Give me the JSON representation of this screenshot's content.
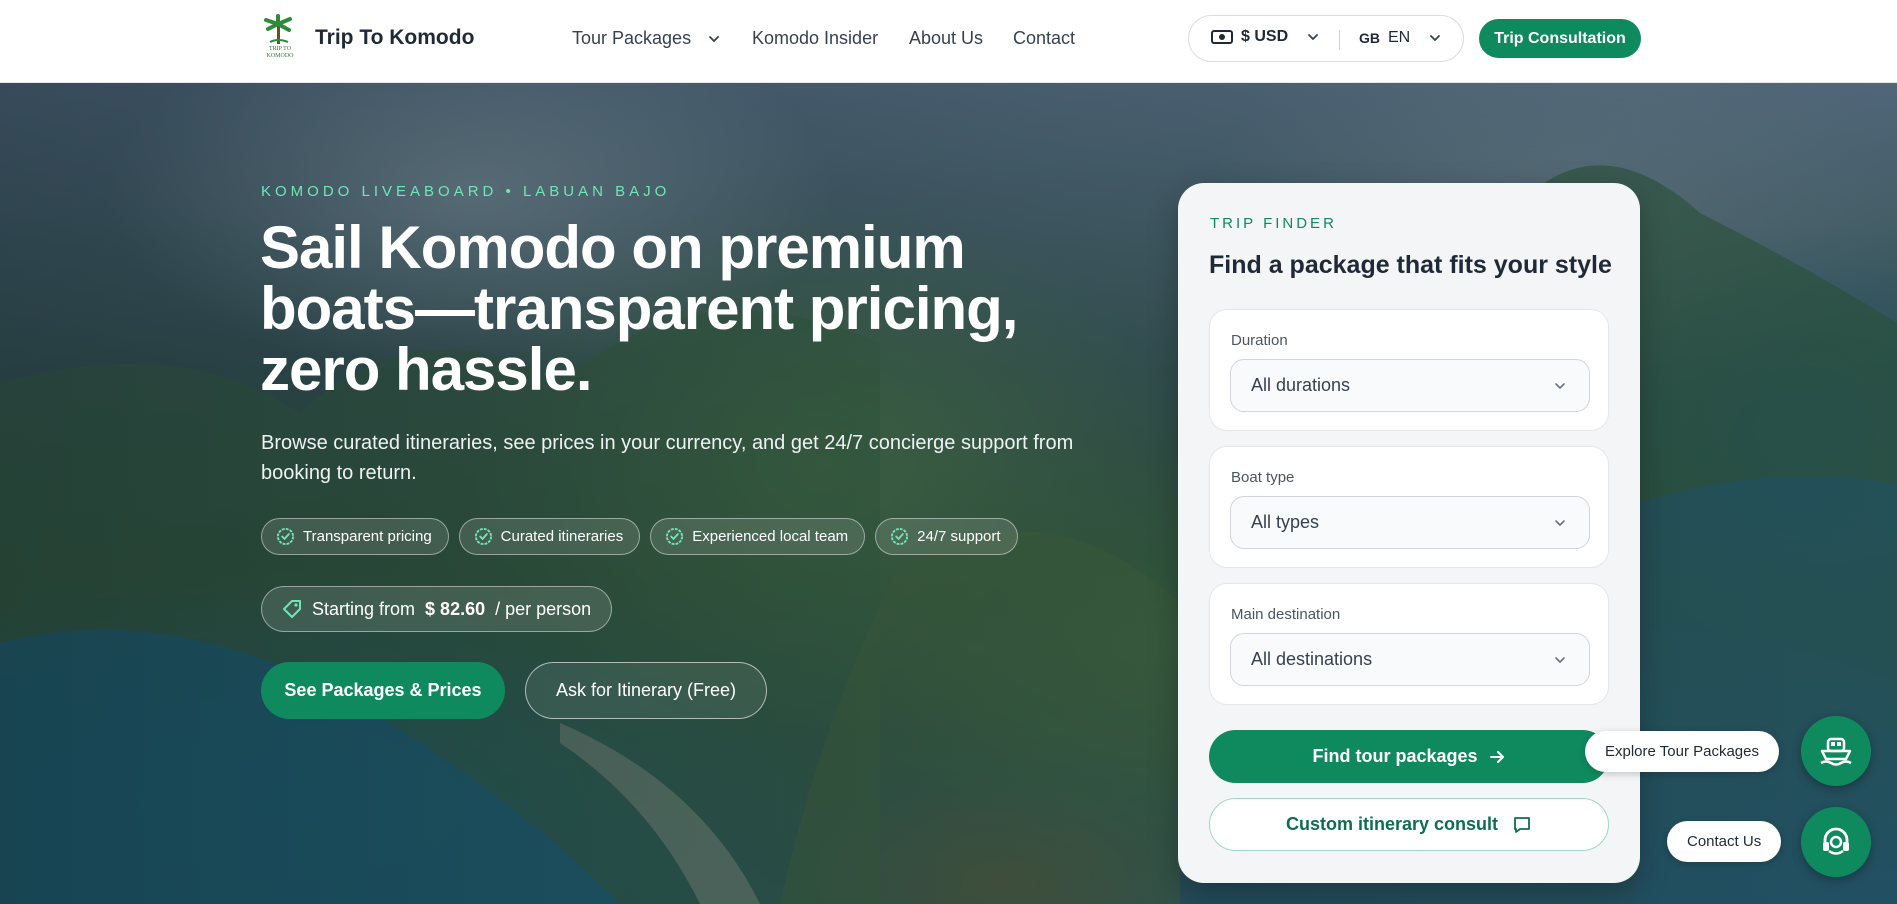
{
  "header": {
    "brand": "Trip To Komodo",
    "logo_text": "TRIP TO KOMODO",
    "nav": [
      {
        "label": "Tour Packages",
        "has_dropdown": true
      },
      {
        "label": "Komodo Insider"
      },
      {
        "label": "About Us"
      },
      {
        "label": "Contact"
      }
    ],
    "currency": "$ USD",
    "lang_flag": "GB",
    "lang_code": "EN",
    "cta": "Trip Consultation"
  },
  "hero": {
    "eyebrow": "KOMODO LIVEABOARD • LABUAN BAJO",
    "headline_line1": "Sail Komodo on premium",
    "headline_line2": "boats—transparent pricing,",
    "headline_line3": "zero hassle.",
    "subtitle": "Browse curated itineraries, see prices in your currency, and get 24/7 concierge support from booking to return.",
    "chips": [
      "Transparent pricing",
      "Curated itineraries",
      "Experienced local team",
      "24/7 support"
    ],
    "price_prefix": "Starting from",
    "price_value": "$ 82.60",
    "price_suffix": "/ per person",
    "primary_cta": "See Packages & Prices",
    "secondary_cta": "Ask for Itinerary (Free)"
  },
  "finder": {
    "eyebrow": "TRIP FINDER",
    "title": "Find a package that fits your style",
    "fields": [
      {
        "label": "Duration",
        "value": "All durations"
      },
      {
        "label": "Boat type",
        "value": "All types"
      },
      {
        "label": "Main destination",
        "value": "All destinations"
      }
    ],
    "find_button": "Find tour packages",
    "custom_button": "Custom itinerary consult"
  },
  "floating": {
    "explore_label": "Explore Tour Packages",
    "contact_label": "Contact Us"
  },
  "colors": {
    "accent": "#0f8a5f",
    "eyebrow": "#6ee7b7"
  },
  "icons": {
    "chevron": "chevron-down-icon",
    "badge": "badge-check-icon",
    "tag": "price-tag-icon",
    "arrow": "arrow-right-icon",
    "chat": "chat-bubble-icon",
    "boat": "boat-icon",
    "headset": "headset-icon",
    "money": "money-icon"
  }
}
